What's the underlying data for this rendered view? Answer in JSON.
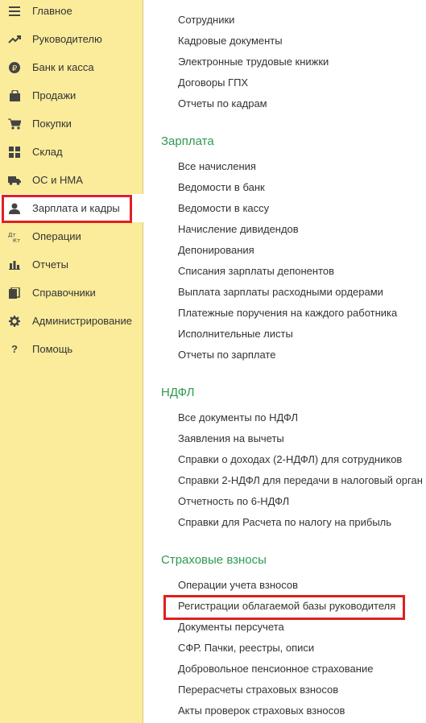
{
  "sidebar": {
    "items": [
      {
        "label": "Главное",
        "icon": "menu-icon"
      },
      {
        "label": "Руководителю",
        "icon": "trend-icon"
      },
      {
        "label": "Банк и касса",
        "icon": "ruble-coin-icon"
      },
      {
        "label": "Продажи",
        "icon": "shopping-bag-icon"
      },
      {
        "label": "Покупки",
        "icon": "cart-icon"
      },
      {
        "label": "Склад",
        "icon": "warehouse-grid-icon"
      },
      {
        "label": "ОС и НМА",
        "icon": "truck-icon"
      },
      {
        "label": "Зарплата и кадры",
        "icon": "person-icon"
      },
      {
        "label": "Операции",
        "icon": "debit-credit-icon"
      },
      {
        "label": "Отчеты",
        "icon": "bar-chart-icon"
      },
      {
        "label": "Справочники",
        "icon": "books-icon"
      },
      {
        "label": "Администрирование",
        "icon": "gear-icon"
      },
      {
        "label": "Помощь",
        "icon": "question-icon"
      }
    ],
    "active_index": 7
  },
  "content": {
    "top_links": [
      "Сотрудники",
      "Кадровые документы",
      "Электронные трудовые книжки",
      "Договоры ГПХ",
      "Отчеты по кадрам"
    ],
    "sections": [
      {
        "title": "Зарплата",
        "links": [
          "Все начисления",
          "Ведомости в банк",
          "Ведомости в кассу",
          "Начисление дивидендов",
          "Депонирования",
          "Списания зарплаты депонентов",
          "Выплата зарплаты расходными ордерами",
          "Платежные поручения на каждого работника",
          "Исполнительные листы",
          "Отчеты по зарплате"
        ]
      },
      {
        "title": "НДФЛ",
        "links": [
          "Все документы по НДФЛ",
          "Заявления на вычеты",
          "Справки о доходах (2-НДФЛ) для сотрудников",
          "Справки 2-НДФЛ для передачи в налоговый орган",
          "Отчетность по 6-НДФЛ",
          "Справки для Расчета по налогу на прибыль"
        ]
      },
      {
        "title": "Страховые взносы",
        "links": [
          "Операции учета взносов",
          "Регистрации облагаемой базы руководителя",
          "Документы персучета",
          "СФР. Пачки, реестры, описи",
          "Добровольное пенсионное страхование",
          "Перерасчеты страховых взносов",
          "Акты проверок страховых взносов"
        ]
      }
    ]
  },
  "colors": {
    "sidebar_bg": "#fbec9b",
    "section_title": "#2f9a4f",
    "highlight": "#e0201f"
  }
}
